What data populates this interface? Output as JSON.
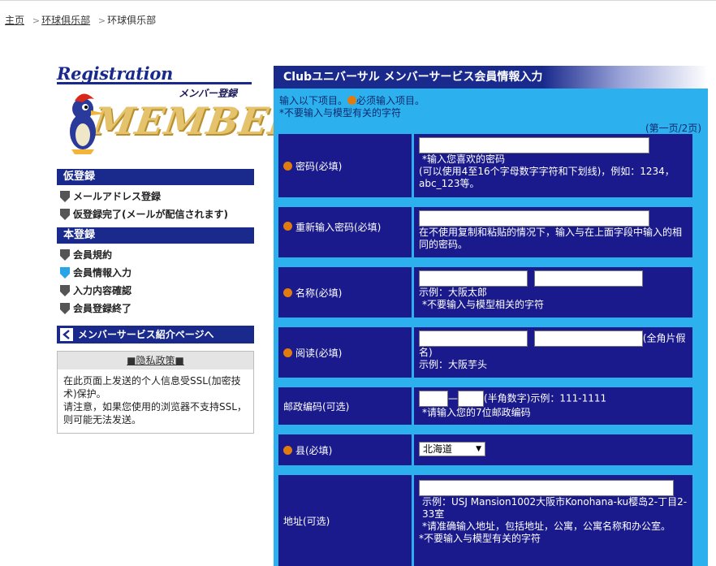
{
  "breadcrumb": {
    "home": "主页",
    "link": "环球俱乐部",
    "current": "环球俱乐部"
  },
  "logo": {
    "registration": "Registration",
    "members_tag": "メンバー登録",
    "members_big": "MEMBERS"
  },
  "sidebar": {
    "prereg_header": "仮登録",
    "prereg_steps": [
      "メールアドレス登録",
      "仮登録完了(メールが配信されます)"
    ],
    "reg_header": "本登録",
    "reg_steps": [
      "会員規約",
      "会員情報入力",
      "入力内容確認",
      "会員登録終了"
    ],
    "active_step": "会員情報入力",
    "intro_link": "メンバーサービス紹介ページへ",
    "privacy_title": "■隐私政策■",
    "privacy_line1": "在此页面上发送的个人信息受SSL(加密技术)保护。",
    "privacy_line2": "请注意，如果您使用的浏览器不支持SSL，则可能无法发送。"
  },
  "main": {
    "title": "Clubユニバーサル メンバーサービス会員情報入力",
    "note1_pre": "输入以下项目。",
    "note1_post": "必须输入项目。",
    "note2": "*不要输入与模型有关的字符",
    "page_info": "(第一页/2页)",
    "colors": {
      "header": "#1a2a8c",
      "panel": "#2db1ee",
      "cell": "#1a1a8c",
      "required_dot": "#e07b10"
    }
  },
  "form": {
    "password": {
      "label": "密码(必填)",
      "hint1": "*输入您喜欢的密码",
      "hint2": "(可以使用4至16个字母数字字符和下划线)，例如：1234，abc_123等。"
    },
    "password2": {
      "label": "重新输入密码(必填)",
      "hint": "在不使用复制和粘贴的情况下，输入与在上面字段中输入的相同的密码。"
    },
    "name": {
      "label": "名称(必填)",
      "example": "示例：大阪太郎",
      "note": "*不要输入与模型相关的字符"
    },
    "reading": {
      "label": "阅读(必填)",
      "suffix": "(全角片假名)",
      "example": "示例：大阪芋头"
    },
    "postal": {
      "label": "邮政编码(可选)",
      "dash": "—",
      "info": "(半角数字)示例：111-1111",
      "note": "*请输入您的7位邮政编码"
    },
    "prefecture": {
      "label": "县(必填)",
      "selected": "北海道"
    },
    "address": {
      "label": "地址(可选)",
      "example": "示例：USJ Mansion1002大阪市Konohana-ku樱岛2-丁目2-33室",
      "note1": "*请准确输入地址，包括地址，公寓，公寓名称和办公室。",
      "note2": "*不要输入与模型有关的字符"
    }
  }
}
